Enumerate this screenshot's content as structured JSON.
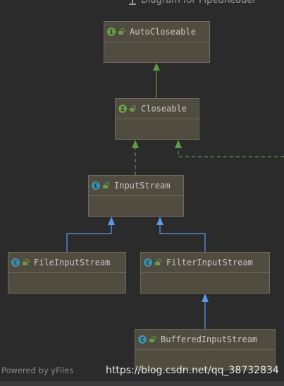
{
  "window": {
    "title": "Diagram for PipedReader"
  },
  "nodes": [
    {
      "id": "autocloseable",
      "kind": "interface",
      "badge": "I",
      "name": "AutoCloseable"
    },
    {
      "id": "closeable",
      "kind": "interface",
      "badge": "I",
      "name": "Closeable"
    },
    {
      "id": "inputstream",
      "kind": "abstract-class",
      "badge": "C",
      "name": "InputStream"
    },
    {
      "id": "fileinputstream",
      "kind": "class",
      "badge": "C",
      "name": "FileInputStream"
    },
    {
      "id": "filterinputstream",
      "kind": "class",
      "badge": "C",
      "name": "FilterInputStream"
    },
    {
      "id": "bufferedinputstream",
      "kind": "class",
      "badge": "C",
      "name": "BufferedInputStream"
    }
  ],
  "edges": [
    {
      "from": "closeable",
      "to": "autocloseable",
      "type": "interface-extends",
      "color": "#5f9a44"
    },
    {
      "from": "inputstream",
      "to": "closeable",
      "type": "implements",
      "color": "#5f9a44"
    },
    {
      "from": "offscreen",
      "to": "closeable",
      "type": "implements",
      "color": "#5f9a44"
    },
    {
      "from": "fileinputstream",
      "to": "inputstream",
      "type": "extends",
      "color": "#5a9be8"
    },
    {
      "from": "filterinputstream",
      "to": "inputstream",
      "type": "extends",
      "color": "#5a9be8"
    },
    {
      "from": "bufferedinputstream",
      "to": "filterinputstream",
      "type": "extends",
      "color": "#5a9be8"
    }
  ],
  "footer": {
    "powered_by": "Powered by yFiles"
  },
  "watermark": "https://blog.csdn.net/qq_38732834",
  "colors": {
    "background": "#2b2b2b",
    "node_fill": "#504c40",
    "implements": "#5f9a44",
    "extends": "#5a9be8"
  }
}
